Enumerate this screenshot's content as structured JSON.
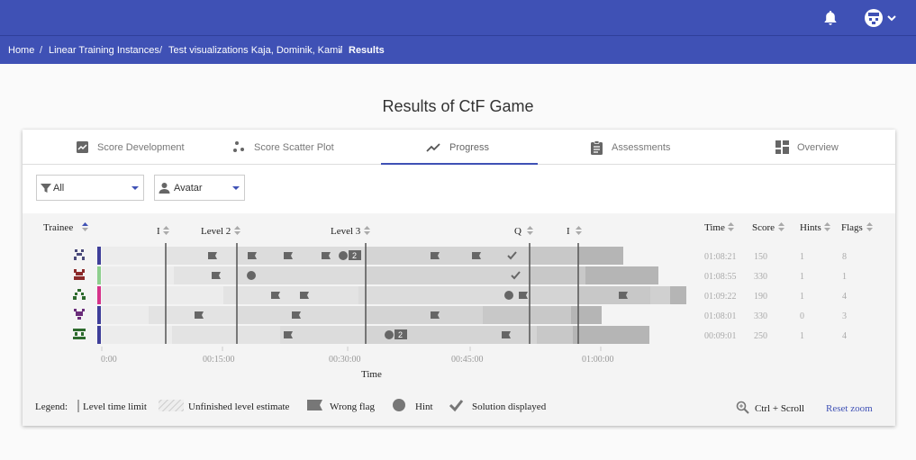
{
  "breadcrumb": {
    "home": "Home",
    "instances": "Linear Training Instances",
    "instance": "Test visualizations Kaja, Dominik, Kamil",
    "current": "Results",
    "separator": "/"
  },
  "page": {
    "title": "Results of CtF Game"
  },
  "tabs": [
    {
      "label": "Score Development",
      "icon": "chart-line-box-icon"
    },
    {
      "label": "Score Scatter Plot",
      "icon": "scatter-icon"
    },
    {
      "label": "Progress",
      "icon": "trending-icon",
      "active": true
    },
    {
      "label": "Assessments",
      "icon": "clipboard-icon"
    },
    {
      "label": "Overview",
      "icon": "dashboard-icon"
    }
  ],
  "filters": {
    "filter_value": "All",
    "display_value": "Avatar"
  },
  "table": {
    "trainee_header": "Trainee",
    "level_headers": [
      "I",
      "Level 2",
      "Level 3",
      "Q",
      "I"
    ],
    "col_headers": [
      "Time",
      "Score",
      "Hints",
      "Flags"
    ],
    "hint_badge": "2",
    "rows": [
      {
        "time": "01:08:21",
        "score": "150",
        "hints": "1",
        "flags": "8",
        "color": "#3f3f9a"
      },
      {
        "time": "01:08:55",
        "score": "330",
        "hints": "1",
        "flags": "1",
        "color": "#8ecf8e"
      },
      {
        "time": "01:09:22",
        "score": "190",
        "hints": "1",
        "flags": "4",
        "color": "#d6338a"
      },
      {
        "time": "01:08:01",
        "score": "330",
        "hints": "0",
        "flags": "3",
        "color": "#3f3f9a"
      },
      {
        "time": "00:09:01",
        "score": "250",
        "hints": "1",
        "flags": "4",
        "color": "#3f3f9a"
      }
    ],
    "time_ticks": [
      "0:00",
      "00:15:00",
      "00:30:00",
      "00:45:00",
      "01:00:00"
    ],
    "time_axis_label": "Time"
  },
  "legend": {
    "title": "Legend:",
    "level_time_limit": "Level time limit",
    "unfinished": "Unfinished level estimate",
    "wrong_flag": "Wrong flag",
    "hint": "Hint",
    "solution": "Solution displayed",
    "zoom_hint": "Ctrl + Scroll",
    "reset_zoom": "Reset zoom"
  },
  "colors": {
    "primary": "#3f51b5"
  }
}
